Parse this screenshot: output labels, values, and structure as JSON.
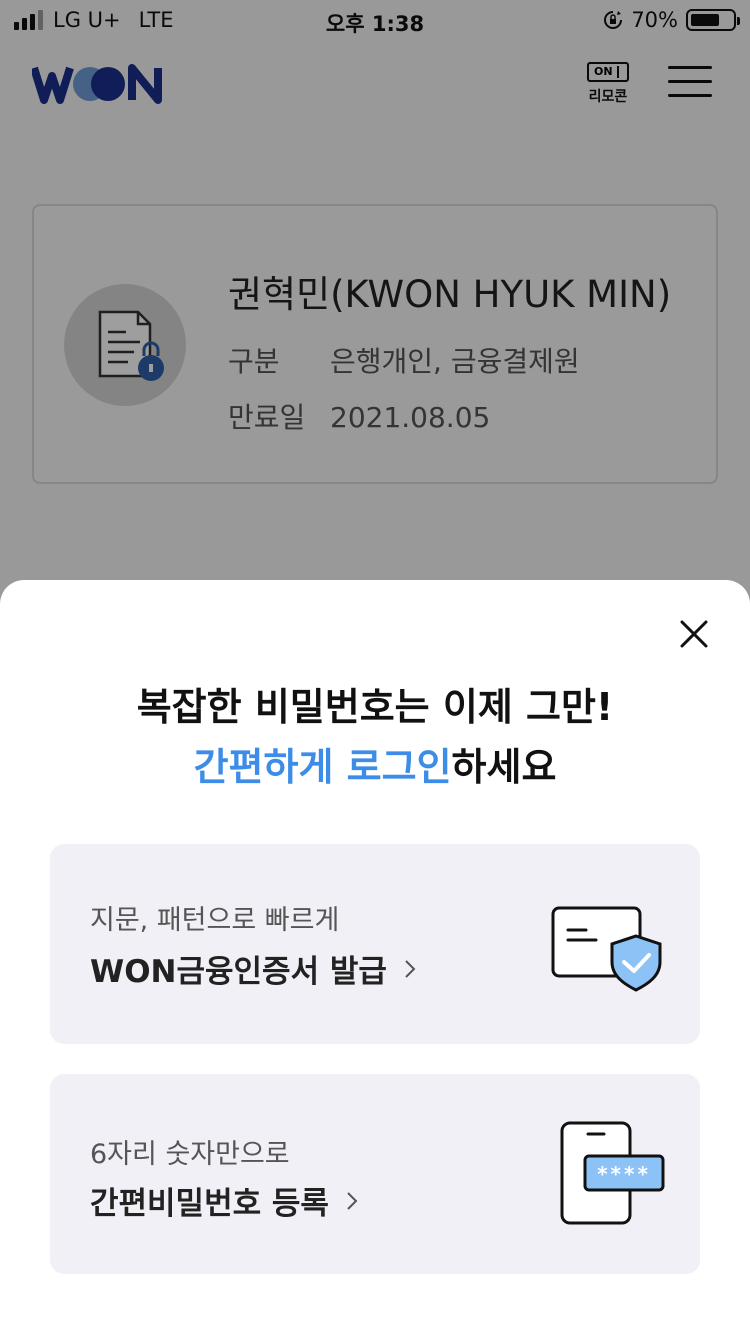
{
  "status_bar": {
    "carrier": "LG U+",
    "network": "LTE",
    "time": "오후 1:38",
    "battery": "70%"
  },
  "header": {
    "logo_text": "WON",
    "remote_badge": "ON",
    "remote_label": "리모콘"
  },
  "certificate": {
    "name": "권혁민(KWON HYUK MIN)",
    "type_label": "구분",
    "type_value": "은행개인, 금융결제원",
    "expiry_label": "만료일",
    "expiry_value": "2021.08.05"
  },
  "sheet": {
    "title": "복잡한 비밀번호는 이제 그만!",
    "subtitle_accent": "간편하게 로그인",
    "subtitle_rest": "하세요",
    "options": [
      {
        "small": "지문, 패턴으로 빠르게",
        "big": "WON금융인증서 발급",
        "icon": "certificate-shield-icon"
      },
      {
        "small": "6자리 숫자만으로",
        "big": "간편비밀번호 등록",
        "icon": "phone-password-icon",
        "mask": "****"
      }
    ]
  },
  "colors": {
    "accent": "#3d8de8",
    "brand": "#1b2f8c",
    "option_bg": "#f1f0f6"
  }
}
